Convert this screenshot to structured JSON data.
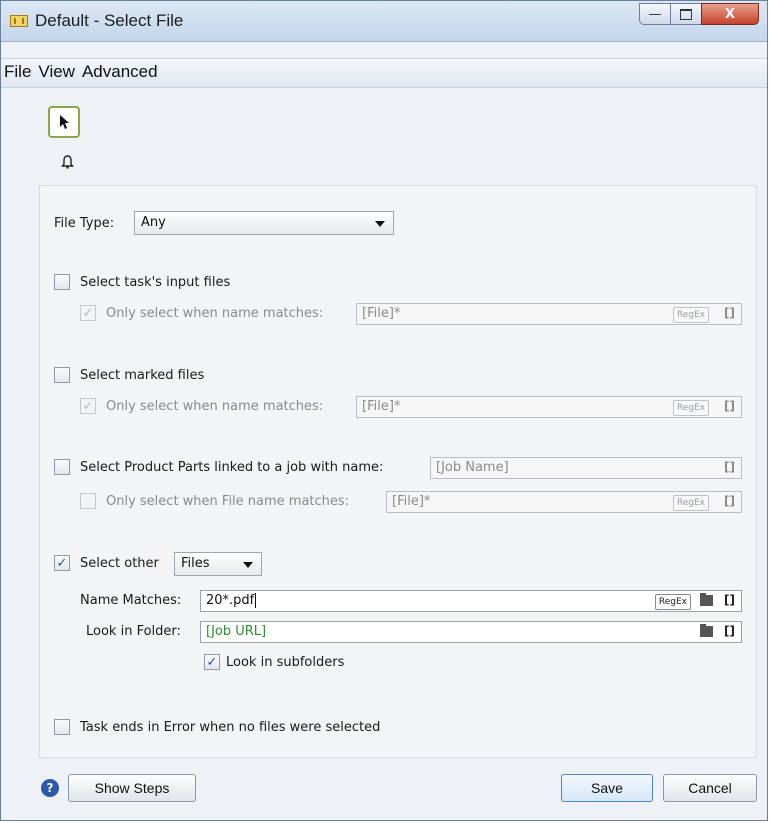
{
  "window": {
    "title": "Default - Select File",
    "close_glyph": "X"
  },
  "menu": [
    "File",
    "View",
    "Advanced"
  ],
  "file_type": {
    "label": "File Type:",
    "value": "Any"
  },
  "task_input": {
    "label": "Select task's input files",
    "only_label": "Only select when name matches:",
    "value": "[File]*",
    "regex": "RegEx",
    "bracket": "[]"
  },
  "marked": {
    "label": "Select marked files",
    "only_label": "Only select when name matches:",
    "value": "[File]*",
    "regex": "RegEx",
    "bracket": "[]"
  },
  "product_parts": {
    "label": "Select Product Parts linked to a job with name:",
    "job_value": "[Job Name]",
    "bracket": "[]",
    "only_label": "Only select when File name matches:",
    "value": "[File]*",
    "regex": "RegEx"
  },
  "other": {
    "label": "Select other",
    "kind": "Files",
    "name_label": "Name Matches:",
    "name_value": "20*.pdf",
    "regex": "RegEx",
    "bracket": "[]",
    "folder_label": "Look in Folder:",
    "folder_value": "[Job URL]",
    "subfolders_label": "Look in subfolders"
  },
  "error_label": "Task ends in Error when no files were selected",
  "buttons": {
    "help": "?",
    "show_steps": "Show Steps",
    "save": "Save",
    "cancel": "Cancel"
  },
  "colors": {
    "accent": "#2a5aa8",
    "green": "#2f8d2f"
  }
}
